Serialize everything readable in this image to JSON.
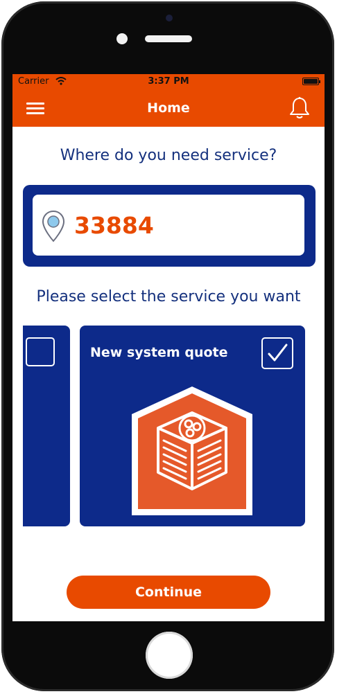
{
  "status_bar": {
    "carrier": "Carrier",
    "time": "3:37 PM"
  },
  "nav": {
    "title": "Home",
    "menu_icon": "hamburger-menu-icon",
    "notification_icon": "bell-icon"
  },
  "location": {
    "prompt": "Where do you need service?",
    "zip_value": "33884",
    "icon": "location-pin-icon"
  },
  "services": {
    "prompt": "Please select the service you want",
    "cards": [
      {
        "title": "",
        "selected": false
      },
      {
        "title": "New system quote",
        "selected": true,
        "icon": "hvac-house-icon"
      }
    ]
  },
  "continue_label": "Continue",
  "colors": {
    "brand_orange": "#e84a00",
    "brand_navy": "#0d2a8a",
    "text_navy": "#14307d"
  }
}
